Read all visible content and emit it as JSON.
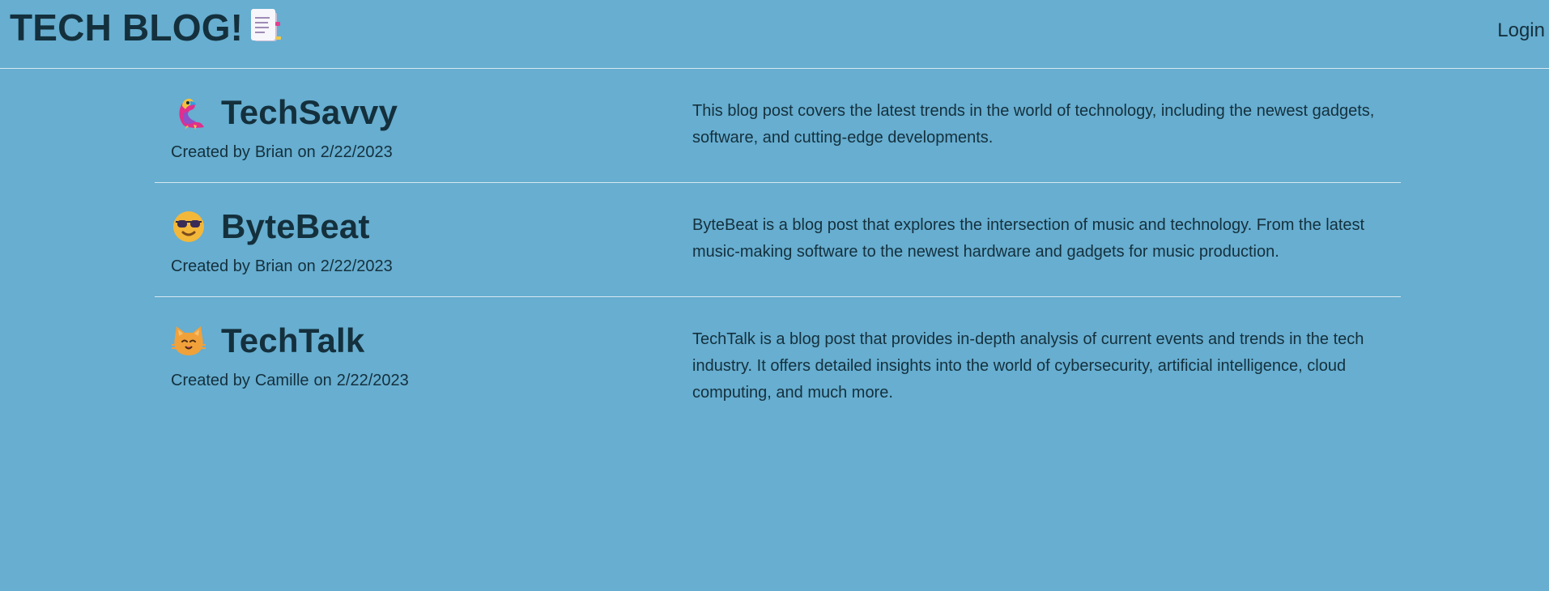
{
  "header": {
    "title": "TECH BLOG!",
    "title_icon": "notebook-icon",
    "login_label": "Login"
  },
  "posts": [
    {
      "icon": "parrot-icon",
      "title": "TechSavvy",
      "meta_prefix": "Created by",
      "author": "Brian",
      "meta_on": "on",
      "date": "2/22/2023",
      "description": "This blog post covers the latest trends in the world of technology, including the newest gadgets, software, and cutting-edge developments."
    },
    {
      "icon": "sunglasses-face-icon",
      "title": "ByteBeat",
      "meta_prefix": "Created by",
      "author": "Brian",
      "meta_on": "on",
      "date": "2/22/2023",
      "description": "ByteBeat is a blog post that explores the intersection of music and technology. From the latest music-making software to the newest hardware and gadgets for music production."
    },
    {
      "icon": "cat-face-icon",
      "title": "TechTalk",
      "meta_prefix": "Created by",
      "author": "Camille",
      "meta_on": "on",
      "date": "2/22/2023",
      "description": "TechTalk is a blog post that provides in-depth analysis of current events and trends in the tech industry. It offers detailed insights into the world of cybersecurity, artificial intelligence, cloud computing, and much more."
    }
  ],
  "colors": {
    "background": "#67aed0",
    "text": "#14303d",
    "divider": "#d7e8f0"
  }
}
